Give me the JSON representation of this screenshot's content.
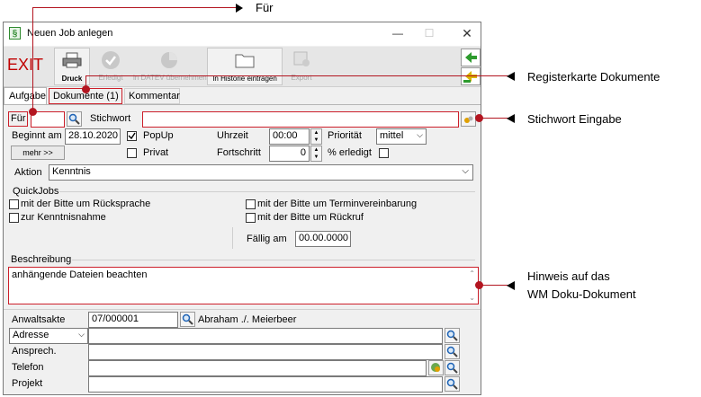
{
  "window": {
    "title": "Neuen Job anlegen"
  },
  "toolbar": {
    "exit_label": "EXIT",
    "druck_label": "Druck",
    "erledigt_label": "Erledigt",
    "termin_label": "in DATEV übernehmen",
    "historie_label": "In Historie eintragen",
    "extra_label": "Export"
  },
  "tabs": [
    {
      "label": "Aufgabe"
    },
    {
      "label": "Dokumente (1)"
    },
    {
      "label": "Kommentar"
    }
  ],
  "form": {
    "fuer_label": "Für",
    "stichwort_label": "Stichwort",
    "beginnt_label": "Beginnt am",
    "beginnt_value": "28.10.2020",
    "mehr_label": "mehr >>",
    "popup_label": "PopUp",
    "privat_label": "Privat",
    "uhrzeit_label": "Uhrzeit",
    "uhrzeit_value": "00:00",
    "fortschritt_label": "Fortschritt",
    "fortschritt_value": "0",
    "prioritaet_label": "Priorität",
    "prioritaet_value": "mittel",
    "erledigt_label": "% erledigt",
    "aktion_label": "Aktion",
    "aktion_value": "Kenntnis",
    "quickjobs_label": "QuickJobs",
    "qj_rueckspache": "mit der Bitte um Rücksprache",
    "qj_kenntnis": "zur Kenntnisnahme",
    "qj_termin": "mit der Bitte um Terminvereinbarung",
    "qj_rueckruf": "mit der Bitte um Rückruf",
    "faellig_label": "Fällig am",
    "faellig_value": "00.00.0000",
    "beschreibung_label": "Beschreibung",
    "beschreibung_value": "anhängende Dateien beachten",
    "anwaltsakte_label": "Anwaltsakte",
    "anwaltsakte_value": "07/000001",
    "anwaltsakte_name": "Abraham ./. Meierbeer",
    "adresse_value": "Adresse",
    "ansprech_label": "Ansprech.",
    "telefon_label": "Telefon",
    "projekt_label": "Projekt"
  },
  "annotations": {
    "fuer": "Für",
    "register": "Registerkarte Dokumente",
    "stichwort": "Stichwort Eingabe",
    "hinweis_1": "Hinweis auf das",
    "hinweis_2": "WM Doku-Dokument"
  },
  "colors": {
    "annotation_red": "#b31520",
    "exit_red": "#c00000"
  }
}
